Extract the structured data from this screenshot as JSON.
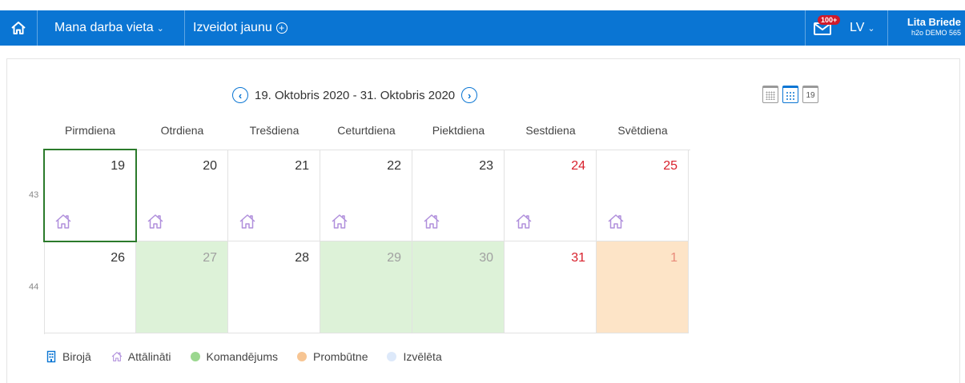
{
  "nav": {
    "workspace_label": "Mana darba vieta",
    "create_label": "Izveidot jaunu",
    "mail_badge": "100+",
    "language": "LV",
    "user_name": "Lita Briede",
    "user_org": "h2o DEMO 565"
  },
  "calendar": {
    "period": "19. Oktobris 2020 - 31. Oktobris 2020",
    "view_day_label": "19",
    "days": [
      "Pirmdiena",
      "Otrdiena",
      "Trešdiena",
      "Ceturtdiena",
      "Piektdiena",
      "Sestdiena",
      "Svētdiena"
    ],
    "weeks": [
      {
        "week_number": "43",
        "cells": [
          {
            "day": "19",
            "status": "remote",
            "weekend": false,
            "selected": true
          },
          {
            "day": "20",
            "status": "remote",
            "weekend": false
          },
          {
            "day": "21",
            "status": "remote",
            "weekend": false
          },
          {
            "day": "22",
            "status": "remote",
            "weekend": false
          },
          {
            "day": "23",
            "status": "remote",
            "weekend": false
          },
          {
            "day": "24",
            "status": "remote",
            "weekend": true
          },
          {
            "day": "25",
            "status": "remote",
            "weekend": true
          }
        ]
      },
      {
        "week_number": "44",
        "cells": [
          {
            "day": "26",
            "status": "none",
            "weekend": false
          },
          {
            "day": "27",
            "status": "mission",
            "weekend": false
          },
          {
            "day": "28",
            "status": "none",
            "weekend": false
          },
          {
            "day": "29",
            "status": "mission",
            "weekend": false
          },
          {
            "day": "30",
            "status": "mission",
            "weekend": false
          },
          {
            "day": "31",
            "status": "none",
            "weekend": true
          },
          {
            "day": "1",
            "status": "absent",
            "weekend": true
          }
        ]
      }
    ]
  },
  "legend": {
    "office": "Birojā",
    "remote": "Attālināti",
    "mission": "Komandējums",
    "absence": "Prombūtne",
    "selected": "Izvēlēta"
  },
  "colors": {
    "brand": "#0a75d3",
    "mission": "#ddf2d8",
    "absence": "#fde4c7",
    "selected": "#dde9fa",
    "remote_icon": "#b08fdc",
    "weekend_text": "#d8202c"
  }
}
